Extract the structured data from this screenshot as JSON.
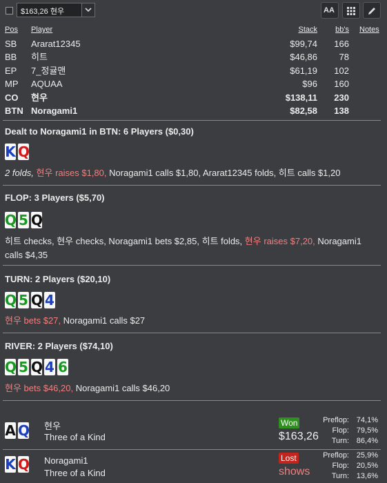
{
  "toolbar": {
    "player_select": "$163,26 현우",
    "font_button": "AA",
    "icons": [
      "checkbox",
      "chevron-down-icon",
      "font-size-icon",
      "grid-icon",
      "pencil-icon"
    ]
  },
  "players": {
    "headers": {
      "pos": "Pos",
      "player": "Player",
      "stack": "Stack",
      "bbs": "bb's",
      "notes": "Notes"
    },
    "rows": [
      {
        "pos": "SB",
        "name": "Ararat12345",
        "stack": "$99,74",
        "bb": "166"
      },
      {
        "pos": "BB",
        "name": "히트",
        "stack": "$46,86",
        "bb": "78"
      },
      {
        "pos": "EP",
        "name": "7_정귤맨",
        "stack": "$61,19",
        "bb": "102"
      },
      {
        "pos": "MP",
        "name": "AQUAA",
        "stack": "$96",
        "bb": "160"
      },
      {
        "pos": "CO",
        "name": "현우",
        "stack": "$138,11",
        "bb": "230"
      },
      {
        "pos": "BTN",
        "name": "Noragami1",
        "stack": "$82,58",
        "bb": "138"
      }
    ]
  },
  "preflop": {
    "title": "Dealt to Noragami1 in BTN: 6 Players ($0,30)",
    "cards": [
      {
        "rank": "K",
        "suit": "d"
      },
      {
        "rank": "Q",
        "suit": "h"
      }
    ],
    "actions": [
      {
        "text": "2 folds, ",
        "style": "italic"
      },
      {
        "text": "현우 raises $1,80,",
        "style": "red"
      },
      {
        "text": " Noragami1 calls $1,80, Ararat12345 folds, 히트 calls $1,20",
        "style": ""
      }
    ]
  },
  "flop": {
    "title": "FLOP: 3 Players ($5,70)",
    "cards": [
      {
        "rank": "Q",
        "suit": "c"
      },
      {
        "rank": "5",
        "suit": "c"
      },
      {
        "rank": "Q",
        "suit": "s"
      }
    ],
    "actions": [
      {
        "text": "히트 checks, 현우 checks, Noragami1 bets $2,85, 히트 folds, ",
        "style": ""
      },
      {
        "text": "현우 raises $7,20,",
        "style": "red"
      },
      {
        "text": " Noragami1 calls $4,35",
        "style": ""
      }
    ]
  },
  "turn": {
    "title": "TURN: 2 Players ($20,10)",
    "cards": [
      {
        "rank": "Q",
        "suit": "c"
      },
      {
        "rank": "5",
        "suit": "c"
      },
      {
        "rank": "Q",
        "suit": "s"
      },
      {
        "rank": "4",
        "suit": "d"
      }
    ],
    "actions": [
      {
        "text": "현우 bets $27,",
        "style": "red"
      },
      {
        "text": " Noragami1 calls $27",
        "style": ""
      }
    ]
  },
  "river": {
    "title": "RIVER: 2 Players ($74,10)",
    "cards": [
      {
        "rank": "Q",
        "suit": "c"
      },
      {
        "rank": "5",
        "suit": "c"
      },
      {
        "rank": "Q",
        "suit": "s"
      },
      {
        "rank": "4",
        "suit": "d"
      },
      {
        "rank": "6",
        "suit": "c"
      }
    ],
    "actions": [
      {
        "text": "현우 bets $46,20,",
        "style": "red"
      },
      {
        "text": " Noragami1 calls $46,20",
        "style": ""
      }
    ]
  },
  "results": [
    {
      "name": "현우",
      "hand": "Three of a Kind",
      "cards": [
        {
          "rank": "A",
          "suit": "s"
        },
        {
          "rank": "Q",
          "suit": "d"
        }
      ],
      "badge": "Won",
      "badge_type": "won",
      "amount": "$163,26",
      "amount_color": "#f0f0f0",
      "equity": [
        {
          "label": "Preflop:",
          "value": "74,1%"
        },
        {
          "label": "Flop:",
          "value": "79,5%"
        },
        {
          "label": "Turn:",
          "value": "86,4%"
        }
      ]
    },
    {
      "name": "Noragami1",
      "hand": "Three of a Kind",
      "cards": [
        {
          "rank": "K",
          "suit": "d"
        },
        {
          "rank": "Q",
          "suit": "h"
        }
      ],
      "badge": "Lost",
      "badge_type": "lost",
      "amount": "shows",
      "amount_color": "#f08080",
      "equity": [
        {
          "label": "Preflop:",
          "value": "25,9%"
        },
        {
          "label": "Flop:",
          "value": "20,5%"
        },
        {
          "label": "Turn:",
          "value": "13,6%"
        }
      ]
    }
  ],
  "colors": {
    "background": "#3b3d40",
    "red_action": "#f08080",
    "club": "#189a21",
    "diamond": "#1b3fbf",
    "heart": "#d21a1a",
    "spade": "#111111"
  }
}
